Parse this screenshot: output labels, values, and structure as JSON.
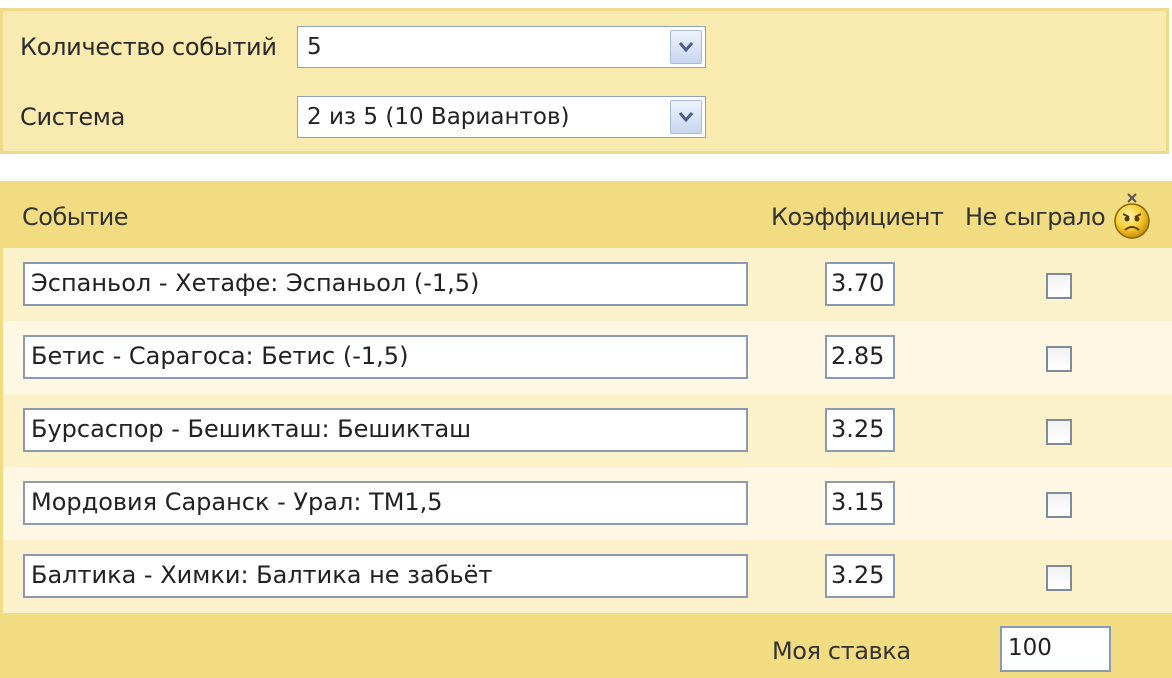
{
  "settings": {
    "event_count_label": "Количество событий",
    "event_count_value": "5",
    "system_label": "Система",
    "system_value": "2 из 5 (10 Вариантов)"
  },
  "table": {
    "header_event": "Событие",
    "header_coef": "Коэффициент",
    "header_not_played": "Не сыграло",
    "rows": [
      {
        "event": "Эспаньол - Хетафе: Эспаньол (-1,5)",
        "coef": "3.70",
        "not_played": false
      },
      {
        "event": "Бетис - Сарагоса: Бетис (-1,5)",
        "coef": "2.85",
        "not_played": false
      },
      {
        "event": "Бурсаспор - Бешикташ: Бешикташ",
        "coef": "3.25",
        "not_played": false
      },
      {
        "event": "Мордовия Саранск - Урал: ТМ1,5",
        "coef": "3.15",
        "not_played": false
      },
      {
        "event": "Балтика - Химки: Балтика не забьёт",
        "coef": "3.25",
        "not_played": false
      }
    ]
  },
  "stake": {
    "label": "Моя ставка",
    "value": "100"
  },
  "icons": {
    "dropdown_arrow": "chevron-down-icon",
    "not_played": "sad-smiley-icon"
  },
  "colors": {
    "panel_bg": "#f9eaaf",
    "panel_border": "#efd98a",
    "table_bg": "#f2dc82",
    "row_odd": "#fbf1cb",
    "row_even": "#fdf7e3",
    "input_border": "#8a9ab0"
  }
}
